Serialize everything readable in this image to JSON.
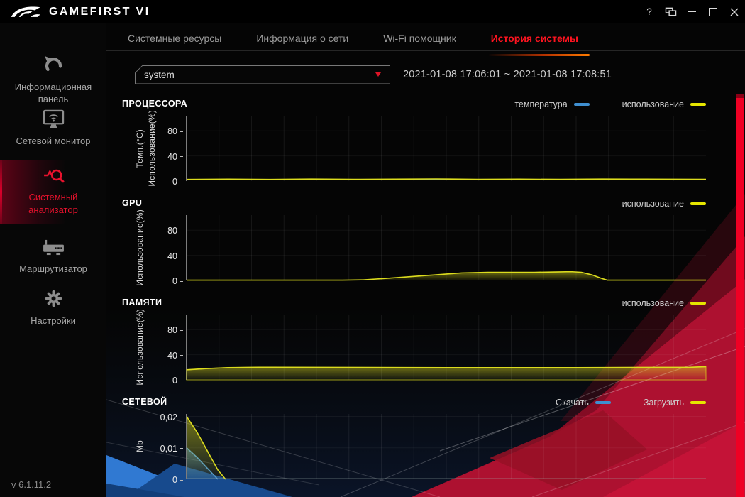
{
  "titlebar": {
    "app_title": "GAMEFIRST VI",
    "help_label": "?"
  },
  "sidebar": {
    "items": [
      {
        "label": "Информационная панель",
        "icon": "dashboard-icon",
        "active": false
      },
      {
        "label": "Сетевой монитор",
        "icon": "network-monitor-icon",
        "active": false
      },
      {
        "label": "Системный анализатор",
        "icon": "system-analyzer-icon",
        "active": true
      },
      {
        "label": "Маршрутизатор",
        "icon": "router-icon",
        "active": false
      },
      {
        "label": "Настройки",
        "icon": "gear-icon",
        "active": false
      }
    ],
    "version": "v 6.1.11.2"
  },
  "tabs": [
    {
      "label": "Системные ресурсы",
      "active": false
    },
    {
      "label": "Информация о сети",
      "active": false
    },
    {
      "label": "Wi-Fi помощник",
      "active": false
    },
    {
      "label": "История системы",
      "active": true
    }
  ],
  "controls": {
    "dropdown_value": "system",
    "date_range": "2021-01-08 17:06:01 ~ 2021-01-08 17:08:51"
  },
  "colors": {
    "accent_red": "#e8122d",
    "tab_underline_orange": "#ff7b00",
    "line_blue": "#4a95d6",
    "line_yellow": "#dcdc1e",
    "legend_yellow": "#e6e600",
    "legend_blue": "#3f8fd0"
  },
  "chart_data": [
    {
      "type": "line",
      "key": "cpu",
      "title": "ПРОЦЕССОРА",
      "ylabels": [
        "Темп.(°C)",
        "Использование(%)"
      ],
      "ylim": [
        0,
        100
      ],
      "yticks": [
        {
          "v": 0,
          "t": "0"
        },
        {
          "v": 40,
          "t": "40"
        },
        {
          "v": 80,
          "t": "80"
        }
      ],
      "series": [
        {
          "name": "температура",
          "color": "#4a95d6",
          "fill": false,
          "points": [
            [
              0,
              2
            ],
            [
              8,
              2
            ],
            [
              16,
              2.3
            ],
            [
              24,
              2
            ],
            [
              32,
              2
            ],
            [
              40,
              2.4
            ],
            [
              48,
              2
            ],
            [
              56,
              2.2
            ],
            [
              64,
              2
            ],
            [
              72,
              2
            ],
            [
              80,
              2.3
            ],
            [
              88,
              2
            ],
            [
              100,
              2
            ]
          ]
        },
        {
          "name": "использование",
          "color": "#dcdc1e",
          "fill": false,
          "points": [
            [
              0,
              2.6
            ],
            [
              8,
              3
            ],
            [
              16,
              2.6
            ],
            [
              24,
              3.2
            ],
            [
              32,
              2.8
            ],
            [
              40,
              3
            ],
            [
              48,
              3.4
            ],
            [
              56,
              2.8
            ],
            [
              64,
              3
            ],
            [
              72,
              2.7
            ],
            [
              80,
              3.2
            ],
            [
              88,
              3
            ],
            [
              100,
              2.8
            ]
          ]
        }
      ]
    },
    {
      "type": "area",
      "key": "gpu",
      "title": "GPU",
      "ylabels": [
        "Использование(%)"
      ],
      "ylim": [
        0,
        100
      ],
      "yticks": [
        {
          "v": 0,
          "t": "0"
        },
        {
          "v": 40,
          "t": "40"
        },
        {
          "v": 80,
          "t": "80"
        }
      ],
      "series": [
        {
          "name": "использование",
          "color": "#dcdc1e",
          "fill": true,
          "points": [
            [
              0,
              0.5
            ],
            [
              30,
              0.5
            ],
            [
              34,
              1
            ],
            [
              38,
              3
            ],
            [
              43,
              6
            ],
            [
              48,
              9
            ],
            [
              53,
              12
            ],
            [
              58,
              13
            ],
            [
              63,
              13
            ],
            [
              67,
              13
            ],
            [
              71,
              13.5
            ],
            [
              74,
              14
            ],
            [
              76,
              13
            ],
            [
              78,
              9
            ],
            [
              80,
              3
            ],
            [
              81,
              0.5
            ],
            [
              100,
              0.5
            ]
          ]
        }
      ]
    },
    {
      "type": "area",
      "key": "memory",
      "title": "ПАМЯТИ",
      "ylabels": [
        "Использование(%)"
      ],
      "ylim": [
        0,
        100
      ],
      "yticks": [
        {
          "v": 0,
          "t": "0"
        },
        {
          "v": 40,
          "t": "40"
        },
        {
          "v": 80,
          "t": "80"
        }
      ],
      "series": [
        {
          "name": "использование",
          "color": "#dcdc1e",
          "fill": true,
          "close_stroke": true,
          "points": [
            [
              0,
              16
            ],
            [
              4,
              18
            ],
            [
              8,
              19.5
            ],
            [
              14,
              20
            ],
            [
              25,
              19.8
            ],
            [
              50,
              19.5
            ],
            [
              75,
              19.5
            ],
            [
              97,
              20
            ],
            [
              100,
              21
            ]
          ]
        }
      ]
    },
    {
      "type": "area",
      "key": "network",
      "title": "СЕТЕВОЙ",
      "ylabels": [
        "Mb"
      ],
      "ylim": [
        0,
        0.02
      ],
      "baseline": true,
      "yticks": [
        {
          "v": 0,
          "t": "0"
        },
        {
          "v": 0.01,
          "t": "0,01"
        },
        {
          "v": 0.02,
          "t": "0,02"
        }
      ],
      "series": [
        {
          "name": "Скачать",
          "color": "#4a95d6",
          "fill": true,
          "points": [
            [
              0,
              0.01
            ],
            [
              2,
              0.007
            ],
            [
              4,
              0.0035
            ],
            [
              6,
              0
            ]
          ]
        },
        {
          "name": "Загрузить",
          "color": "#dcdc1e",
          "fill": true,
          "points": [
            [
              0,
              0.02
            ],
            [
              2,
              0.015
            ],
            [
              4,
              0.009
            ],
            [
              6,
              0.003
            ],
            [
              7.5,
              0
            ]
          ]
        }
      ]
    }
  ]
}
